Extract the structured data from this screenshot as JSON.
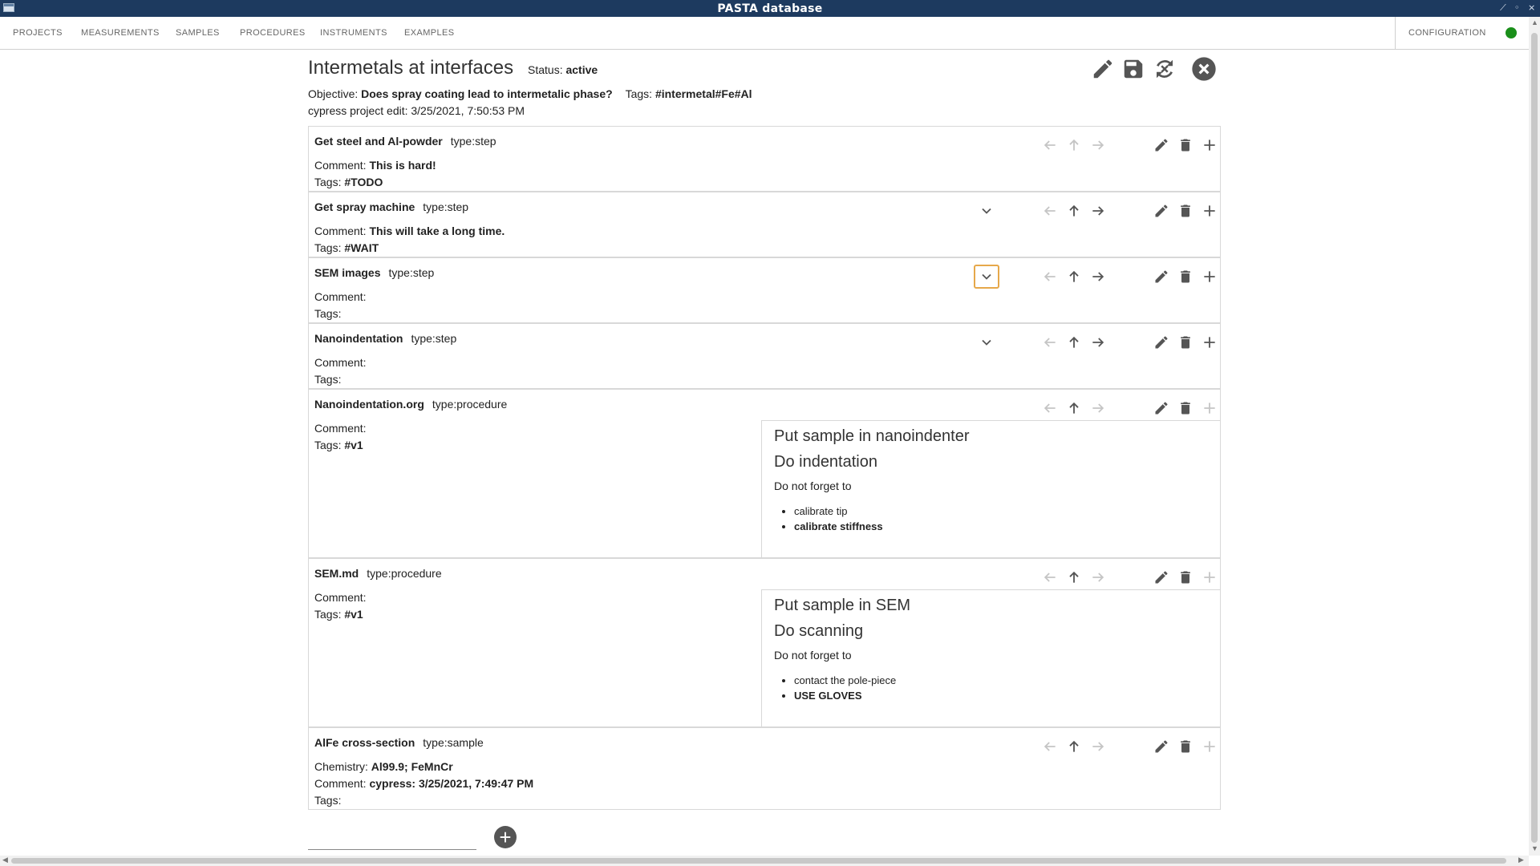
{
  "window": {
    "title": "PASTA database",
    "controls": [
      "⟋",
      "◦",
      "⨯"
    ]
  },
  "nav": {
    "tabs": [
      "PROJECTS",
      "MEASUREMENTS",
      "SAMPLES",
      "PROCEDURES",
      "INSTRUMENTS",
      "EXAMPLES"
    ],
    "config_label": "CONFIGURATION",
    "status_color": "#1a8f1a"
  },
  "project": {
    "title": "Intermetals at interfaces",
    "status_label": "Status:",
    "status_value": "active",
    "objective_label": "Objective:",
    "objective_value": "Does spray coating lead to intermetalic phase?",
    "tags_label": "Tags:",
    "tags_value": "#intermetal#Fe#Al",
    "edit_line": "cypress project edit: 3/25/2021, 7:50:53 PM"
  },
  "header_actions": [
    "edit-icon",
    "save-icon",
    "refresh-icon",
    "close-icon"
  ],
  "items": [
    {
      "name": "Get steel and Al-powder",
      "type": "type:step",
      "comment_label": "Comment:",
      "comment": "This is hard!",
      "tags_label": "Tags:",
      "tags": "#TODO"
    },
    {
      "name": "Get spray machine",
      "type": "type:step",
      "comment_label": "Comment:",
      "comment": "This will take a long time.",
      "tags_label": "Tags:",
      "tags": "#WAIT"
    },
    {
      "name": "SEM images",
      "type": "type:step",
      "comment_label": "Comment:",
      "comment": "",
      "tags_label": "Tags:",
      "tags": ""
    },
    {
      "name": "Nanoindentation",
      "type": "type:step",
      "comment_label": "Comment:",
      "comment": "",
      "tags_label": "Tags:",
      "tags": ""
    },
    {
      "name": "Nanoindentation.org",
      "type": "type:procedure",
      "comment_label": "Comment:",
      "comment": "",
      "tags_label": "Tags:",
      "tags": "#v1",
      "content": {
        "h1": "Put sample in nanoindenter",
        "h2": "Do indentation",
        "p": "Do not forget to",
        "list": [
          "calibrate tip",
          "calibrate stiffness"
        ]
      }
    },
    {
      "name": "SEM.md",
      "type": "type:procedure",
      "comment_label": "Comment:",
      "comment": "",
      "tags_label": "Tags:",
      "tags": "#v1",
      "content": {
        "h1": "Put sample in SEM",
        "h2": "Do scanning",
        "p": "Do not forget to",
        "list": [
          "contact the pole-piece",
          "USE GLOVES"
        ]
      }
    },
    {
      "name": "AlFe cross-section",
      "type": "type:sample",
      "chemistry_label": "Chemistry:",
      "chemistry": "Al99.9; FeMnCr",
      "comment_label": "Comment:",
      "comment": "cypress: 3/25/2021, 7:49:47 PM",
      "tags_label": "Tags:",
      "tags": ""
    }
  ],
  "add_button_label": "+"
}
